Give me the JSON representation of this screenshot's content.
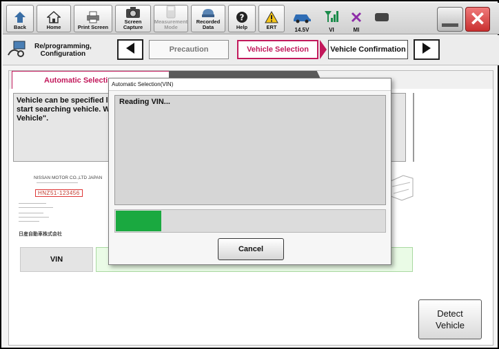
{
  "toolbar": {
    "back": "Back",
    "home": "Home",
    "print_screen": "Print Screen",
    "screen_capture": "Screen\nCapture",
    "measurement_mode": "Measurement\nMode",
    "recorded_data": "Recorded\nData",
    "help": "Help",
    "ert": "ERT",
    "voltage": "14.5V",
    "vi": "VI",
    "mi": "MI"
  },
  "nav": {
    "reprogramming": "Re/programming,\nConfiguration",
    "steps": [
      "Precaution",
      "Vehicle Selection",
      "Vehicle Confirmation"
    ]
  },
  "tabs": {
    "automatic": "Automatic Selecti",
    "manual": ""
  },
  "info": {
    "text": "Vehicle can be specified l\nstart searching vehicle. W\nVehicle\"."
  },
  "plate": {
    "company": "NISSAN MOTOR CO.,LTD JAPAN",
    "vin": "HNZ51-123456",
    "footer": "日産自動車株式会社"
  },
  "vin": {
    "label": "VIN",
    "value": ""
  },
  "detect": {
    "label": "Detect\nVehicle"
  },
  "dialog": {
    "title": "Automatic Selection(VIN)",
    "message": "Reading VIN...",
    "progress": 0.17,
    "cancel": "Cancel"
  },
  "colors": {
    "accent": "#c2185b",
    "progress": "#1aa940",
    "vin_field": "#eafbe6"
  }
}
